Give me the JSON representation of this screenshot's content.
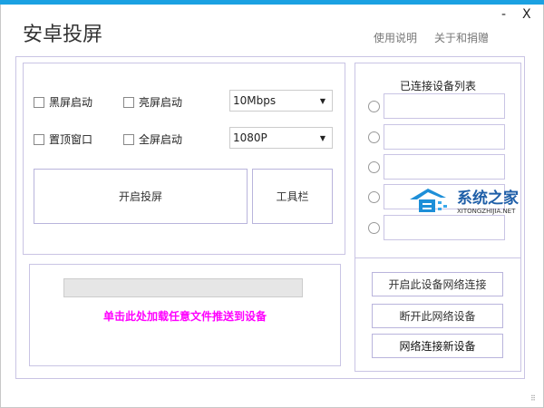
{
  "window": {
    "title": "安卓投屏",
    "minimize": "-",
    "close": "X"
  },
  "header_links": {
    "help": "使用说明",
    "about": "关于和捐赠"
  },
  "options": {
    "black_screen": "黑屏启动",
    "bright_screen": "亮屏启动",
    "topmost": "置顶窗口",
    "fullscreen": "全屏启动"
  },
  "bitrate": {
    "selected": "10Mbps"
  },
  "resolution": {
    "selected": "1080P"
  },
  "buttons": {
    "start": "开启投屏",
    "toolbar": "工具栏"
  },
  "upload": {
    "progress": 0,
    "hint": "单击此处加载任意文件推送到设备"
  },
  "devices": {
    "title": "已连接设备列表",
    "items": [
      "",
      "",
      "",
      "",
      ""
    ]
  },
  "network": {
    "enable": "开启此设备网络连接",
    "disconnect": "断开此网络设备",
    "connect_new": "网络连接新设备"
  },
  "watermark": {
    "name": "系统之家",
    "url": "XITONGZHIJIA.NET"
  },
  "colors": {
    "accent": "#1ba1e2",
    "hint": "#ff00ff"
  }
}
